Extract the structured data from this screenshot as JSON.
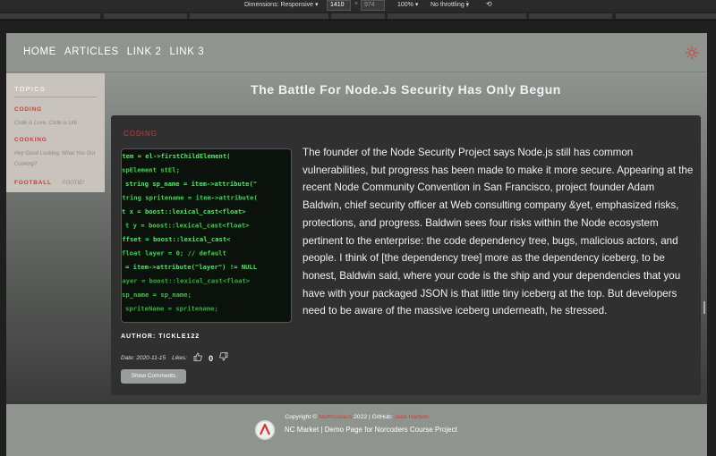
{
  "devtools": {
    "dimensions_label": "Dimensions: Responsive ▾",
    "width": "1410",
    "times": "×",
    "height": "974",
    "zoom": "100% ▾",
    "throttling": "No throttling ▾",
    "more_icon": "vertical-ellipsis",
    "rotate_icon": "rotate"
  },
  "nav": {
    "links": [
      "HOME",
      "ARTICLES",
      "LINK 2",
      "LINK 3"
    ],
    "theme_icon": "sun-icon"
  },
  "sidebar": {
    "title": "TOPICS",
    "topics": [
      {
        "name": "CODING",
        "description": "Code is Love, Code is Life"
      },
      {
        "name": "COOKING",
        "description": "Hey Good Looking, What You Got Cooking?"
      },
      {
        "name": "FOOTBALL",
        "description": "FOOTIE!"
      }
    ]
  },
  "article": {
    "title": "The Battle For Node.Js Security Has Only Begun",
    "topic": "CODING",
    "body": "The founder of the Node Security Project says Node.js still has common vulnerabilities, but progress has been made to make it more secure. Appearing at the recent Node Community Convention in San Francisco, project founder Adam Baldwin, chief security officer at Web consulting company &yet, emphasized risks, protections, and progress. Baldwin sees four risks within the Node ecosystem pertinent to the enterprise: the code dependency tree, bugs, malicious actors, and people. I think of [the dependency tree] more as the dependency iceberg, to be honest, Baldwin said, where your code is the ship and your dependencies that you have with your packaged JSON is that little tiny iceberg at the top. But developers need to be aware of the massive iceberg underneath, he stressed.",
    "author": "AUTHOR: TICKLE122",
    "date": "Date: 2020-11-15",
    "likes_label": "Likes:",
    "likes_count": "0",
    "show_comments": "Show Comments",
    "image_code_lines": [
      "item = el->firstChildElement(",
      "spElement stEl;",
      "string sp_name = item->attribute(\"",
      "string spritename = item->attribute(",
      "t x = boost::lexical_cast<float>",
      "t y = boost::lexical_cast<float>",
      "offset = boost::lexical_cast<",
      "float layer = 0; // default",
      "= item->attribute(\"layer\") != NULL",
      "layer = boost::lexical_cast<float>",
      "sp_name = sp_name;",
      "spriteName = spritename;"
    ]
  },
  "footer": {
    "copyright_prefix": "Copyright © ",
    "org": "Northcoders",
    "year_github": " 2022 | GitHub: ",
    "github_user": "Jack Harbon",
    "tagline": "NC Market | Demo Page for Norcoders Course Project"
  },
  "colors": {
    "accent": "#d23a3a",
    "nav_bg": "#8f948f",
    "card_bg": "#303030",
    "sidebar_bg": "#c9c3bd"
  }
}
